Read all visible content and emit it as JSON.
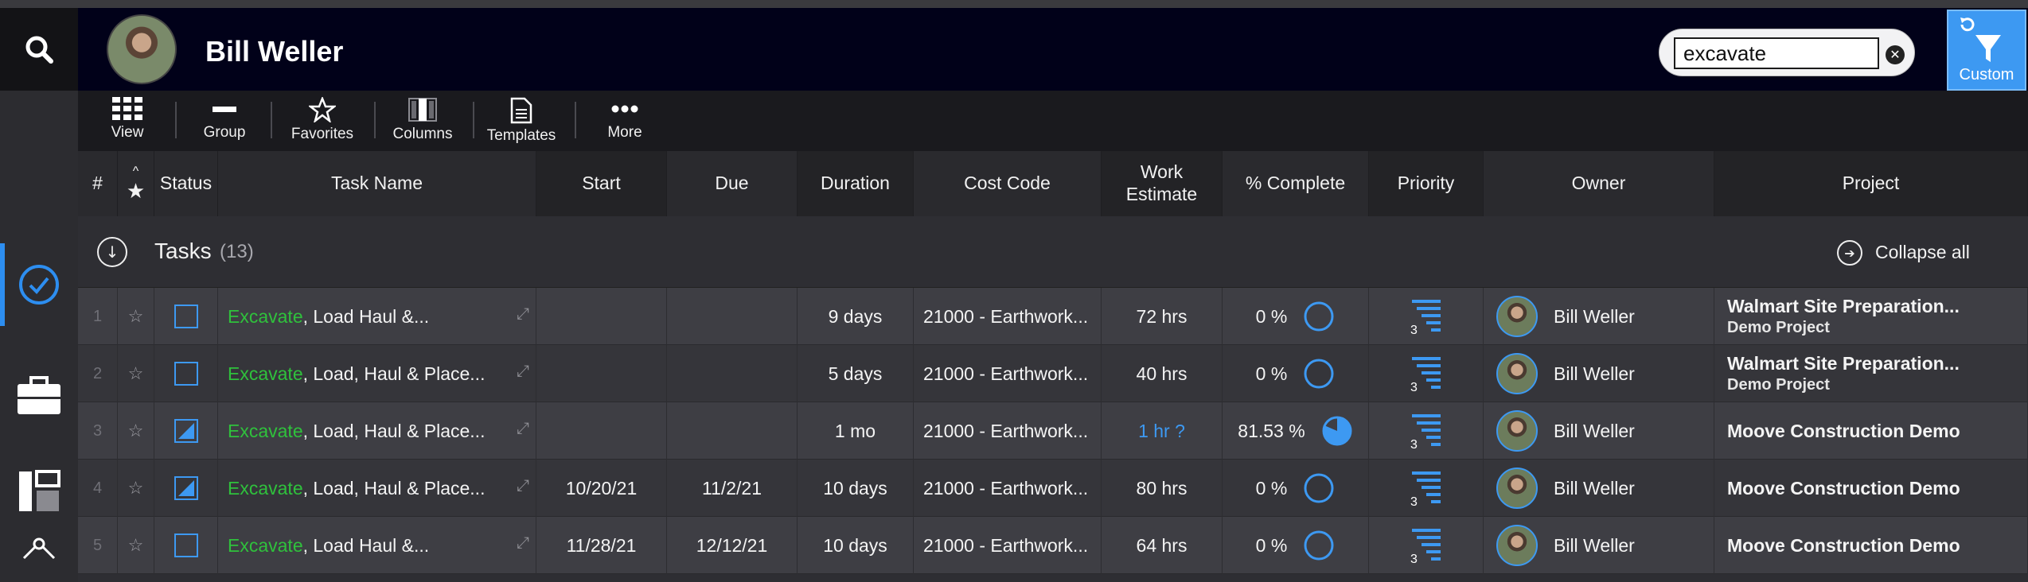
{
  "header": {
    "user_name": "Bill Weller",
    "search_value": "excavate",
    "custom_label": "Custom"
  },
  "toolbar": {
    "view": "View",
    "group": "Group",
    "favorites": "Favorites",
    "columns": "Columns",
    "templates": "Templates",
    "more": "More"
  },
  "columns": {
    "num": "#",
    "star": "★",
    "status": "Status",
    "task_name": "Task Name",
    "start": "Start",
    "due": "Due",
    "duration": "Duration",
    "cost_code": "Cost Code",
    "work_estimate_1": "Work",
    "work_estimate_2": "Estimate",
    "pct_complete": "% Complete",
    "priority": "Priority",
    "owner": "Owner",
    "project": "Project"
  },
  "group": {
    "title": "Tasks",
    "count": "(13)",
    "collapse_all": "Collapse all"
  },
  "rows": [
    {
      "num": "1",
      "status": "unchecked",
      "task_highlight": "Excavate",
      "task_rest": ", Load Haul &...",
      "start": "",
      "due": "",
      "duration": "9 days",
      "cost_code": "21000 - Earthwork...",
      "work": "72 hrs",
      "pct": "0 %",
      "pct_fill": 0,
      "priority": "3",
      "owner": "Bill Weller",
      "project": "Walmart Site Preparation...",
      "project_sub": "Demo Project"
    },
    {
      "num": "2",
      "status": "unchecked",
      "task_highlight": "Excavate",
      "task_rest": ", Load, Haul & Place...",
      "start": "",
      "due": "",
      "duration": "5 days",
      "cost_code": "21000 - Earthwork...",
      "work": "40 hrs",
      "pct": "0 %",
      "pct_fill": 0,
      "priority": "3",
      "owner": "Bill Weller",
      "project": "Walmart Site Preparation...",
      "project_sub": "Demo Project"
    },
    {
      "num": "3",
      "status": "partial",
      "task_highlight": "Excavate",
      "task_rest": ", Load, Haul & Place...",
      "start": "",
      "due": "",
      "duration": "1 mo",
      "cost_code": "21000 - Earthwork...",
      "work": "1 hr ?",
      "pct": "81.53 %",
      "pct_fill": 0.8153,
      "priority": "3",
      "owner": "Bill Weller",
      "project": "Moove Construction Demo",
      "project_sub": ""
    },
    {
      "num": "4",
      "status": "partial",
      "task_highlight": "Excavate",
      "task_rest": ", Load, Haul & Place...",
      "start": "10/20/21",
      "due": "11/2/21",
      "duration": "10 days",
      "cost_code": "21000 - Earthwork...",
      "work": "80 hrs",
      "pct": "0 %",
      "pct_fill": 0,
      "priority": "3",
      "owner": "Bill Weller",
      "project": "Moove Construction Demo",
      "project_sub": ""
    },
    {
      "num": "5",
      "status": "unchecked",
      "task_highlight": "Excavate",
      "task_rest": ", Load Haul &...",
      "start": "11/28/21",
      "due": "12/12/21",
      "duration": "10 days",
      "cost_code": "21000 - Earthwork...",
      "work": "64 hrs",
      "pct": "0 %",
      "pct_fill": 0,
      "priority": "3",
      "owner": "Bill Weller",
      "project": "Moove Construction Demo",
      "project_sub": ""
    }
  ],
  "colors": {
    "accent": "#3d99f2",
    "highlight": "#2fc13c",
    "header_bg": "#010119"
  }
}
